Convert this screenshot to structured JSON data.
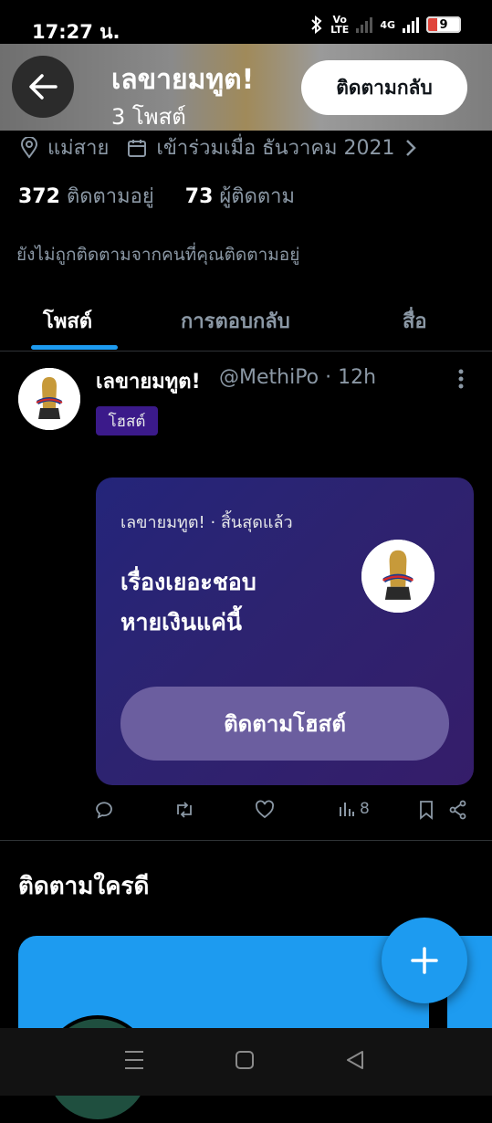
{
  "status_bar": {
    "time": "17:27 น.",
    "volte_label_top": "Vo",
    "volte_label_bottom": "LTE",
    "network_label": "4G",
    "battery_level": "9",
    "battery_color": "#e0453b"
  },
  "header": {
    "title": "เลขายมทูต!",
    "subtitle": "3 โพสต์",
    "follow_back_label": "ติดตามกลับ",
    "back_icon": "arrow-left-icon"
  },
  "profile": {
    "location": "แม่สาย",
    "joined": "เข้าร่วมเมื่อ ธันวาคม 2021",
    "following_count": "372",
    "following_label": "ติดตามอยู่",
    "followers_count": "73",
    "followers_label": "ผู้ติดตาม",
    "not_followed_note": "ยังไม่ถูกติดตามจากคนที่คุณติดตามอยู่"
  },
  "tabs": [
    {
      "label": "โพสต์",
      "active": true
    },
    {
      "label": "การตอบกลับ",
      "active": false
    },
    {
      "label": "สื่อ",
      "active": false
    }
  ],
  "post": {
    "author_name": "เลขายมทูต!",
    "handle_time": "@MethiPo · 12h",
    "badge": "โฮสต์",
    "space_card": {
      "meta": "เลขายมทูต! · สิ้นสุดแล้ว",
      "title_line1": "เรื่องเยอะชอบ",
      "title_line2": "หายเงินแค่นี้",
      "follow_host_label": "ติดตามโฮสต์"
    },
    "actions": {
      "views": "8"
    }
  },
  "who_to_follow": {
    "title": "ติดตามใครดี"
  },
  "colors": {
    "accent": "#1d9bf0",
    "badge_bg": "#3b1a8a",
    "card_bg": "#2d2370",
    "muted": "#8b98a5"
  }
}
